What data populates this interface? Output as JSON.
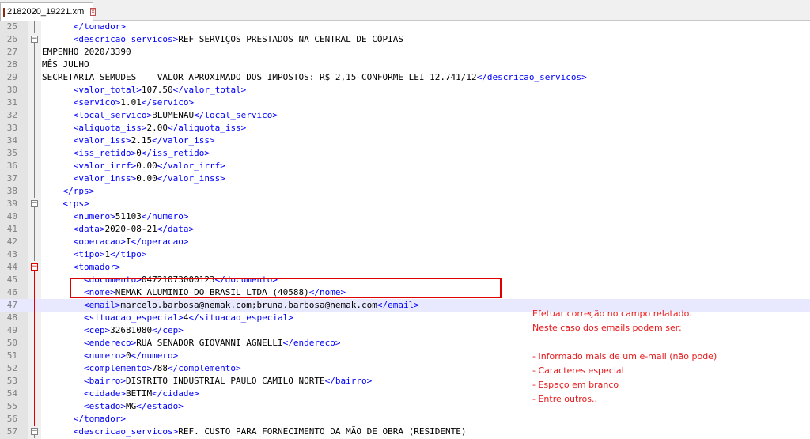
{
  "tab": {
    "title": "2182020_19221.xml",
    "close_glyph": "x"
  },
  "lines": [
    {
      "n": "25",
      "indent": "      ",
      "parts": [
        {
          "t": "</tomador>",
          "tag": true
        }
      ],
      "fold": "none",
      "vl": "gray"
    },
    {
      "n": "26",
      "indent": "      ",
      "parts": [
        {
          "t": "<descricao_servicos>",
          "tag": true
        },
        {
          "t": "REF SERVIÇOS PRESTADOS NA CENTRAL DE CÓPIAS",
          "tag": false
        }
      ],
      "fold": "minus",
      "vl": "gray"
    },
    {
      "n": "27",
      "indent": "",
      "parts": [
        {
          "t": "EMPENHO 2020/3390",
          "tag": false
        }
      ],
      "fold": "none",
      "vl": "gray"
    },
    {
      "n": "28",
      "indent": "",
      "parts": [
        {
          "t": "MÊS JULHO",
          "tag": false
        }
      ],
      "fold": "none",
      "vl": "gray"
    },
    {
      "n": "29",
      "indent": "",
      "parts": [
        {
          "t": "SECRETARIA SEMUDES    VALOR APROXIMADO DOS IMPOSTOS: R$ 2,15 CONFORME LEI 12.741/12",
          "tag": false
        },
        {
          "t": "</descricao_servicos>",
          "tag": true
        }
      ],
      "fold": "none",
      "vl": "gray"
    },
    {
      "n": "30",
      "indent": "      ",
      "parts": [
        {
          "t": "<valor_total>",
          "tag": true
        },
        {
          "t": "107.50",
          "tag": false
        },
        {
          "t": "</valor_total>",
          "tag": true
        }
      ],
      "fold": "none",
      "vl": "gray"
    },
    {
      "n": "31",
      "indent": "      ",
      "parts": [
        {
          "t": "<servico>",
          "tag": true
        },
        {
          "t": "1.01",
          "tag": false
        },
        {
          "t": "</servico>",
          "tag": true
        }
      ],
      "fold": "none",
      "vl": "gray"
    },
    {
      "n": "32",
      "indent": "      ",
      "parts": [
        {
          "t": "<local_servico>",
          "tag": true
        },
        {
          "t": "BLUMENAU",
          "tag": false
        },
        {
          "t": "</local_servico>",
          "tag": true
        }
      ],
      "fold": "none",
      "vl": "gray"
    },
    {
      "n": "33",
      "indent": "      ",
      "parts": [
        {
          "t": "<aliquota_iss>",
          "tag": true
        },
        {
          "t": "2.00",
          "tag": false
        },
        {
          "t": "</aliquota_iss>",
          "tag": true
        }
      ],
      "fold": "none",
      "vl": "gray"
    },
    {
      "n": "34",
      "indent": "      ",
      "parts": [
        {
          "t": "<valor_iss>",
          "tag": true
        },
        {
          "t": "2.15",
          "tag": false
        },
        {
          "t": "</valor_iss>",
          "tag": true
        }
      ],
      "fold": "none",
      "vl": "gray"
    },
    {
      "n": "35",
      "indent": "      ",
      "parts": [
        {
          "t": "<iss_retido>",
          "tag": true
        },
        {
          "t": "0",
          "tag": false
        },
        {
          "t": "</iss_retido>",
          "tag": true
        }
      ],
      "fold": "none",
      "vl": "gray"
    },
    {
      "n": "36",
      "indent": "      ",
      "parts": [
        {
          "t": "<valor_irrf>",
          "tag": true
        },
        {
          "t": "0.00",
          "tag": false
        },
        {
          "t": "</valor_irrf>",
          "tag": true
        }
      ],
      "fold": "none",
      "vl": "gray"
    },
    {
      "n": "37",
      "indent": "      ",
      "parts": [
        {
          "t": "<valor_inss>",
          "tag": true
        },
        {
          "t": "0.00",
          "tag": false
        },
        {
          "t": "</valor_inss>",
          "tag": true
        }
      ],
      "fold": "none",
      "vl": "gray"
    },
    {
      "n": "38",
      "indent": "    ",
      "parts": [
        {
          "t": "</rps>",
          "tag": true
        }
      ],
      "fold": "none",
      "vl": "gray"
    },
    {
      "n": "39",
      "indent": "    ",
      "parts": [
        {
          "t": "<rps>",
          "tag": true
        }
      ],
      "fold": "minus",
      "vl": "gray"
    },
    {
      "n": "40",
      "indent": "      ",
      "parts": [
        {
          "t": "<numero>",
          "tag": true
        },
        {
          "t": "51103",
          "tag": false
        },
        {
          "t": "</numero>",
          "tag": true
        }
      ],
      "fold": "none",
      "vl": "gray"
    },
    {
      "n": "41",
      "indent": "      ",
      "parts": [
        {
          "t": "<data>",
          "tag": true
        },
        {
          "t": "2020-08-21",
          "tag": false
        },
        {
          "t": "</data>",
          "tag": true
        }
      ],
      "fold": "none",
      "vl": "gray"
    },
    {
      "n": "42",
      "indent": "      ",
      "parts": [
        {
          "t": "<operacao>",
          "tag": true
        },
        {
          "t": "I",
          "tag": false
        },
        {
          "t": "</operacao>",
          "tag": true
        }
      ],
      "fold": "none",
      "vl": "gray"
    },
    {
      "n": "43",
      "indent": "      ",
      "parts": [
        {
          "t": "<tipo>",
          "tag": true
        },
        {
          "t": "1",
          "tag": false
        },
        {
          "t": "</tipo>",
          "tag": true
        }
      ],
      "fold": "none",
      "vl": "gray"
    },
    {
      "n": "44",
      "indent": "      ",
      "parts": [
        {
          "t": "<tomador>",
          "tag": true
        }
      ],
      "fold": "minus-red",
      "vl": "gray"
    },
    {
      "n": "45",
      "indent": "        ",
      "parts": [
        {
          "t": "<documento>",
          "tag": true
        },
        {
          "t": "04721073000123",
          "tag": false
        },
        {
          "t": "</documento>",
          "tag": true
        }
      ],
      "fold": "none",
      "vl": "red"
    },
    {
      "n": "46",
      "indent": "        ",
      "parts": [
        {
          "t": "<nome>",
          "tag": true
        },
        {
          "t": "NEMAK ALUMINIO DO BRASIL LTDA (40588)",
          "tag": false
        },
        {
          "t": "</nome>",
          "tag": true
        }
      ],
      "fold": "none",
      "vl": "red"
    },
    {
      "n": "47",
      "indent": "        ",
      "parts": [
        {
          "t": "<email>",
          "tag": true
        },
        {
          "t": "marcelo.barbosa@nemak.com;bruna.barbosa@nemak.com",
          "tag": false
        },
        {
          "t": "</email>",
          "tag": true
        }
      ],
      "fold": "none",
      "vl": "red",
      "current": true
    },
    {
      "n": "48",
      "indent": "        ",
      "parts": [
        {
          "t": "<situacao_especial>",
          "tag": true
        },
        {
          "t": "4",
          "tag": false
        },
        {
          "t": "</situacao_especial>",
          "tag": true
        }
      ],
      "fold": "none",
      "vl": "red"
    },
    {
      "n": "49",
      "indent": "        ",
      "parts": [
        {
          "t": "<cep>",
          "tag": true
        },
        {
          "t": "32681080",
          "tag": false
        },
        {
          "t": "</cep>",
          "tag": true
        }
      ],
      "fold": "none",
      "vl": "red"
    },
    {
      "n": "50",
      "indent": "        ",
      "parts": [
        {
          "t": "<endereco>",
          "tag": true
        },
        {
          "t": "RUA SENADOR GIOVANNI AGNELLI",
          "tag": false
        },
        {
          "t": "</endereco>",
          "tag": true
        }
      ],
      "fold": "none",
      "vl": "red"
    },
    {
      "n": "51",
      "indent": "        ",
      "parts": [
        {
          "t": "<numero>",
          "tag": true
        },
        {
          "t": "0",
          "tag": false
        },
        {
          "t": "</numero>",
          "tag": true
        }
      ],
      "fold": "none",
      "vl": "red"
    },
    {
      "n": "52",
      "indent": "        ",
      "parts": [
        {
          "t": "<complemento>",
          "tag": true
        },
        {
          "t": "788",
          "tag": false
        },
        {
          "t": "</complemento>",
          "tag": true
        }
      ],
      "fold": "none",
      "vl": "red"
    },
    {
      "n": "53",
      "indent": "        ",
      "parts": [
        {
          "t": "<bairro>",
          "tag": true
        },
        {
          "t": "DISTRITO INDUSTRIAL PAULO CAMILO NORTE",
          "tag": false
        },
        {
          "t": "</bairro>",
          "tag": true
        }
      ],
      "fold": "none",
      "vl": "red"
    },
    {
      "n": "54",
      "indent": "        ",
      "parts": [
        {
          "t": "<cidade>",
          "tag": true
        },
        {
          "t": "BETIM",
          "tag": false
        },
        {
          "t": "</cidade>",
          "tag": true
        }
      ],
      "fold": "none",
      "vl": "red"
    },
    {
      "n": "55",
      "indent": "        ",
      "parts": [
        {
          "t": "<estado>",
          "tag": true
        },
        {
          "t": "MG",
          "tag": false
        },
        {
          "t": "</estado>",
          "tag": true
        }
      ],
      "fold": "none",
      "vl": "red"
    },
    {
      "n": "56",
      "indent": "      ",
      "parts": [
        {
          "t": "</tomador>",
          "tag": true
        }
      ],
      "fold": "none",
      "vl": "red"
    },
    {
      "n": "57",
      "indent": "      ",
      "parts": [
        {
          "t": "<descricao_servicos>",
          "tag": true
        },
        {
          "t": "REF. CUSTO PARA FORNECIMENTO DA MÃO DE OBRA (RESIDENTE)",
          "tag": false
        }
      ],
      "fold": "minus",
      "vl": "gray"
    }
  ],
  "annotation": {
    "lines": [
      "Efetuar correção no campo relatado.",
      "Neste caso dos emails podem ser:",
      "",
      "- Informado mais de um e-mail (não pode)",
      "- Caracteres especial",
      "- Espaço em branco",
      "- Entre outros.."
    ]
  },
  "colors": {
    "tag": "#0000ff",
    "text": "#000000",
    "annotation": "#e8191b",
    "highlight_border": "#e00000"
  }
}
